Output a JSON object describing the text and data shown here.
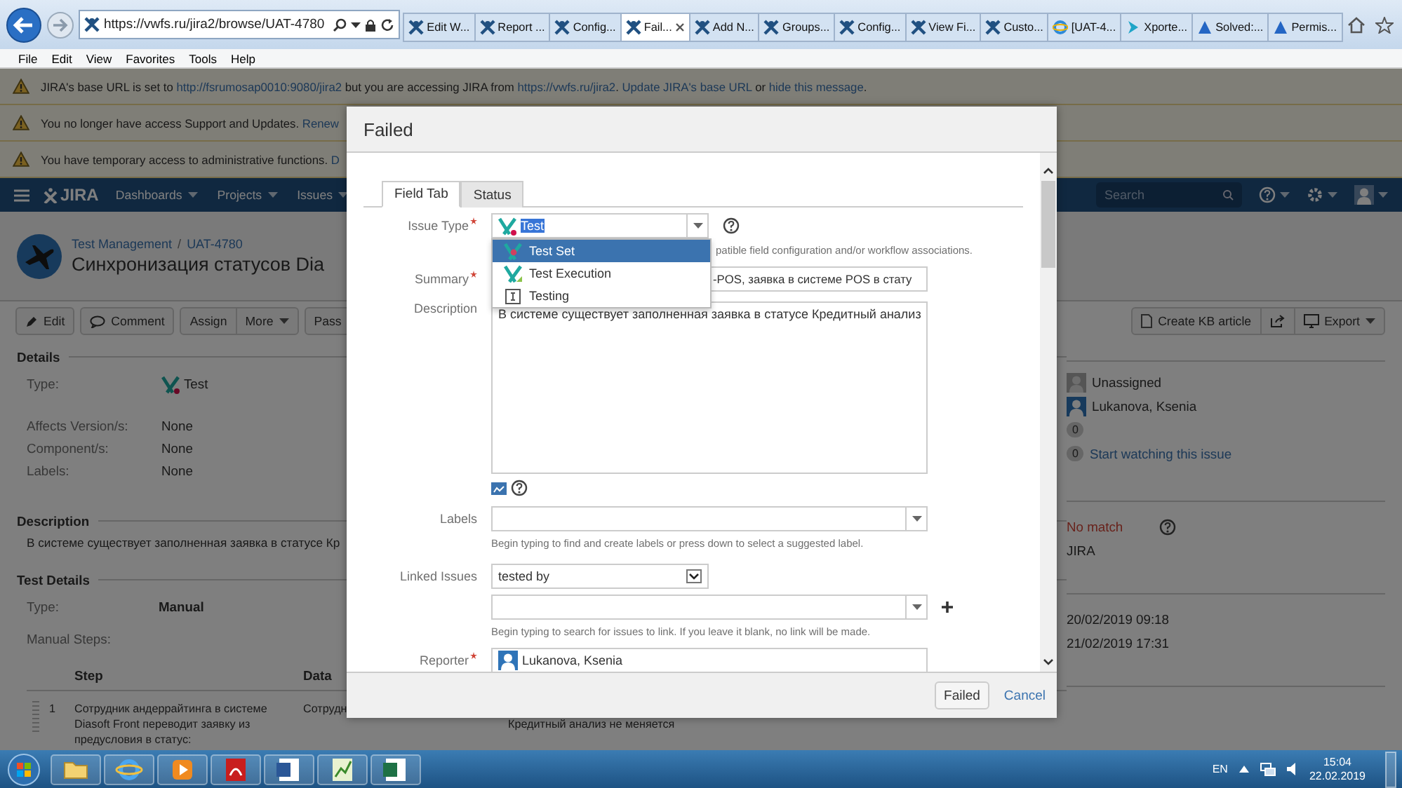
{
  "browser": {
    "address": "https://vwfs.ru/jira2/browse/UAT-4780",
    "tabs": [
      {
        "label": "Edit W...",
        "kind": "jira",
        "selected": false
      },
      {
        "label": "Report ...",
        "kind": "jira",
        "selected": false
      },
      {
        "label": "Config...",
        "kind": "jira",
        "selected": false
      },
      {
        "label": "Fail...",
        "kind": "jira",
        "selected": true
      },
      {
        "label": "Add N...",
        "kind": "jira",
        "selected": false
      },
      {
        "label": "Groups...",
        "kind": "jira",
        "selected": false
      },
      {
        "label": "Config...",
        "kind": "jira",
        "selected": false
      },
      {
        "label": "View Fi...",
        "kind": "jira",
        "selected": false
      },
      {
        "label": "Custo...",
        "kind": "jira",
        "selected": false
      },
      {
        "label": "[UAT-4...",
        "kind": "ie",
        "selected": false
      },
      {
        "label": "Xporte...",
        "kind": "arrow",
        "selected": false
      },
      {
        "label": "Solved:...",
        "kind": "atlassian",
        "selected": false
      },
      {
        "label": "Permis...",
        "kind": "atlassian",
        "selected": false
      }
    ],
    "menu": [
      "File",
      "Edit",
      "View",
      "Favorites",
      "Tools",
      "Help"
    ]
  },
  "banners": [
    {
      "parts": [
        {
          "kind": "text",
          "text": "JIRA's base URL is set to "
        },
        {
          "kind": "link",
          "text": "http://fsrumosap0010:9080/jira2"
        },
        {
          "kind": "text",
          "text": " but you are accessing JIRA from "
        },
        {
          "kind": "link",
          "text": "https://vwfs.ru/jira2"
        },
        {
          "kind": "text",
          "text": ". "
        },
        {
          "kind": "link",
          "text": "Update JIRA's base URL"
        },
        {
          "kind": "text",
          "text": " or "
        },
        {
          "kind": "link",
          "text": "hide this message"
        },
        {
          "kind": "text",
          "text": "."
        }
      ]
    },
    {
      "parts": [
        {
          "kind": "text",
          "text": "You no longer have access Support and Updates. "
        },
        {
          "kind": "link",
          "text": "Renew"
        }
      ]
    },
    {
      "parts": [
        {
          "kind": "text",
          "text": "You have temporary access to administrative functions. "
        },
        {
          "kind": "link",
          "text": "D"
        }
      ]
    }
  ],
  "nav": {
    "logo": "JIRA",
    "items": [
      "Dashboards",
      "Projects",
      "Issues"
    ],
    "search_placeholder": "Search"
  },
  "issue": {
    "project": "Test Management",
    "separator": "/",
    "key": "UAT-4780",
    "title": "Синхронизация статусов Dia"
  },
  "toolbar": {
    "left": [
      [
        {
          "kind": "pencil",
          "label": "Edit"
        }
      ],
      [
        {
          "kind": "bubble",
          "label": "Comment"
        }
      ],
      [
        {
          "kind": "plain",
          "label": "Assign"
        },
        {
          "kind": "menu",
          "label": "More"
        }
      ],
      [
        {
          "kind": "plain",
          "label": "Pass"
        }
      ]
    ],
    "right": [
      [
        {
          "kind": "doc",
          "label": "Create KB article"
        },
        {
          "kind": "share"
        },
        {
          "kind": "export",
          "label": "Export"
        }
      ]
    ]
  },
  "details": {
    "heading": "Details",
    "rows": [
      {
        "label": "Type:",
        "value": "Test",
        "kind": "issue-type"
      },
      {
        "label": "Affects Version/s:",
        "value": "None",
        "kind": "text"
      },
      {
        "label": "Component/s:",
        "value": "None",
        "kind": "text"
      },
      {
        "label": "Labels:",
        "value": "None",
        "kind": "text"
      }
    ]
  },
  "description": {
    "heading": "Description",
    "text": "В системе существует заполненная заявка в статусе Кр"
  },
  "test_details": {
    "heading": "Test Details",
    "type_label": "Type:",
    "type_value": "Manual",
    "steps_label": "Manual Steps:",
    "columns": [
      "Step",
      "Data"
    ],
    "rows": [
      {
        "number": "1",
        "step": "Сотрудник андеррайтинга в системе Diasoft Front переводит заявку из предусловия в статус:",
        "data": "Сотрудн",
        "column_3": "Кредитный анализ не меняется"
      }
    ]
  },
  "people": {
    "assignee": "Unassigned",
    "reporter": "Lukanova, Ksenia",
    "votes": "0",
    "watchers": "0",
    "watch_link": "Start watching this issue"
  },
  "match": {
    "status": "No match",
    "value": "JIRA"
  },
  "dates": [
    "20/02/2019 09:18",
    "21/02/2019 17:31"
  ],
  "dialog": {
    "title": "Failed",
    "tabs": [
      {
        "label": "Field Tab",
        "selected": true
      },
      {
        "label": "Status",
        "selected": false
      }
    ],
    "issue_type": {
      "label": "Issue Type",
      "required": true,
      "value": "Test",
      "hint": "patible field configuration and/or workflow associations.",
      "options": [
        {
          "label": "Test Set",
          "kind": "test-set",
          "selected": true
        },
        {
          "label": "Test Execution",
          "kind": "test-execution",
          "selected": false
        },
        {
          "label": "Testing",
          "kind": "testing",
          "selected": false
        }
      ]
    },
    "summary": {
      "label": "Summary",
      "required": true,
      "value": "-POS, заявка в системе POS в стату"
    },
    "description": {
      "label": "Description",
      "value": "В системе существует заполненная заявка в статусе Кредитный анализ"
    },
    "labels": {
      "label": "Labels",
      "hint": "Begin typing to find and create labels or press down to select a suggested label."
    },
    "linked": {
      "label": "Linked Issues",
      "relation": "tested by",
      "hint": "Begin typing to search for issues to link. If you leave it blank, no link will be made."
    },
    "reporter": {
      "label": "Reporter",
      "required": true,
      "value": "Lukanova, Ksenia"
    },
    "submit": "Failed",
    "cancel": "Cancel"
  },
  "taskbar": {
    "apps": [
      {
        "kind": "folder"
      },
      {
        "kind": "browser"
      },
      {
        "kind": "media"
      },
      {
        "kind": "pdf"
      },
      {
        "kind": "document"
      },
      {
        "kind": "chart"
      },
      {
        "kind": "spreadsheet"
      }
    ],
    "language": "EN",
    "time": "15:04",
    "date": "22.02.2019"
  }
}
